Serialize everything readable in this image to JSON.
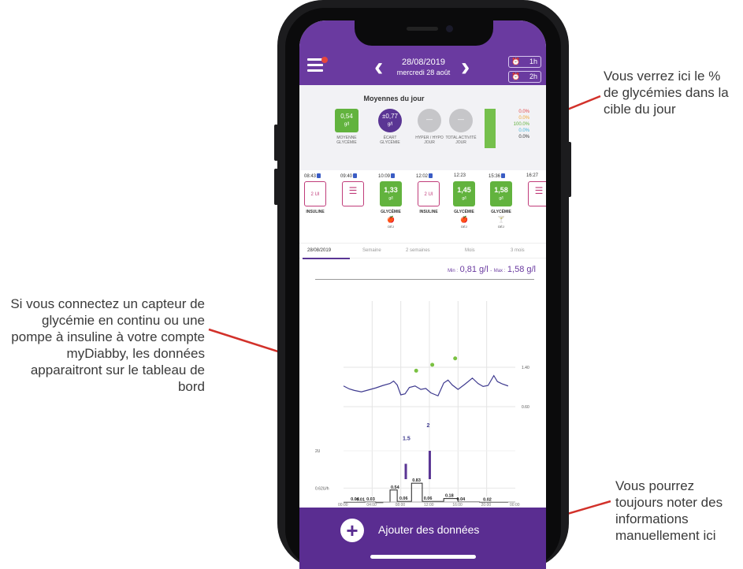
{
  "annotations": {
    "right_top": "Vous verrez ici le % de glycémies dans la cible du jour",
    "left_middle": "Si vous connectez un capteur de glycémie en continu ou une pompe à insuline à votre compte myDiabby, les données apparaitront sur le tableau de bord",
    "right_bottom": "Vous pourrez toujours noter des informations manuellement ici"
  },
  "header": {
    "date": "28/08/2019",
    "day": "mercredi 28 août",
    "timer1": "1h",
    "timer2": "2h"
  },
  "moyennes": {
    "title": "Moyennes du jour",
    "stats": [
      {
        "value": "0,54",
        "unit": "g/l",
        "label": "MOYENNE GLYCÉMIE"
      },
      {
        "value": "±0,77",
        "unit": "g/l",
        "label": "ÉCART GLYCÉMIE"
      },
      {
        "value": "—",
        "unit": "",
        "label": "HYPER / HYPO JOUR"
      },
      {
        "value": "—",
        "unit": "",
        "label": "TOTAL ACTIVITÉ JOUR"
      }
    ],
    "percentages": [
      "0.0%",
      "0.0%",
      "100.0%",
      "0.0%",
      "0.0%"
    ],
    "in_target_fraction": 1.0
  },
  "timeline": [
    {
      "time": "08:43",
      "type": "outline",
      "value": "2 UI",
      "label": "INSULINE",
      "sub": ""
    },
    {
      "time": "09:40",
      "type": "list",
      "value": "☰",
      "label": "",
      "sub": ""
    },
    {
      "time": "10:09",
      "type": "green",
      "value": "1,33",
      "unit": "g/l",
      "label": "GLYCÉMIE",
      "sub": "DÉJ"
    },
    {
      "time": "12:02",
      "type": "outline",
      "value": "2 UI",
      "label": "INSULINE",
      "sub": ""
    },
    {
      "time": "12:23",
      "type": "green",
      "value": "1,45",
      "unit": "g/l",
      "label": "GLYCÉMIE",
      "sub": "DÉJ"
    },
    {
      "time": "15:36",
      "type": "green",
      "value": "1,58",
      "unit": "g/l",
      "label": "GLYCÉMIE",
      "sub": "DÉJ"
    },
    {
      "time": "16:27",
      "type": "list",
      "value": "☰",
      "label": "",
      "sub": ""
    }
  ],
  "tabs": [
    "28/08/2019",
    "Semaine",
    "2 semaines",
    "Mois",
    "3 mois"
  ],
  "minmax": {
    "min_label": "Min :",
    "min": "0,81 g/l",
    "sep": "-",
    "max_label": "Max :",
    "max": "1,58 g/l"
  },
  "chart_data": {
    "type": "line",
    "x_ticks": [
      "00:00",
      "04:00",
      "08:00",
      "12:00",
      "16:00",
      "20:00",
      "00:00"
    ],
    "glucose_ref_labels": [
      "1.40",
      "0.60"
    ],
    "insulin_ref_labels": [
      "2U",
      "0.62U/h"
    ],
    "bolus_labels": [
      "1.5",
      "2"
    ],
    "basal_labels": [
      "0.04",
      "0.01",
      "0.03",
      "0.54",
      "0.06",
      "0.83",
      "0.06",
      "0.18",
      "0.04",
      "0.02"
    ],
    "cgm_points": [
      [
        0.0,
        1.02
      ],
      [
        0.8,
        0.96
      ],
      [
        1.5,
        0.93
      ],
      [
        2.5,
        0.9
      ],
      [
        3.5,
        0.94
      ],
      [
        4.5,
        0.98
      ],
      [
        5.5,
        1.03
      ],
      [
        6.5,
        1.07
      ],
      [
        7.0,
        1.12
      ],
      [
        7.5,
        1.04
      ],
      [
        8.0,
        0.84
      ],
      [
        8.6,
        0.86
      ],
      [
        9.2,
        0.99
      ],
      [
        10.0,
        1.02
      ],
      [
        10.8,
        0.95
      ],
      [
        11.5,
        0.97
      ],
      [
        12.2,
        0.88
      ],
      [
        13.2,
        0.82
      ],
      [
        14.0,
        1.08
      ],
      [
        14.6,
        1.14
      ],
      [
        15.2,
        1.04
      ],
      [
        16.0,
        0.95
      ],
      [
        17.0,
        1.06
      ],
      [
        18.0,
        1.18
      ],
      [
        18.8,
        1.07
      ],
      [
        19.5,
        1.01
      ],
      [
        20.2,
        1.03
      ],
      [
        21.0,
        1.23
      ],
      [
        21.5,
        1.11
      ],
      [
        22.2,
        1.06
      ],
      [
        23.0,
        1.02
      ]
    ],
    "glucose_readings": [
      [
        10.15,
        1.33
      ],
      [
        12.4,
        1.45
      ],
      [
        15.6,
        1.58
      ]
    ],
    "bolus_events": [
      [
        8.7,
        1.5
      ],
      [
        12.05,
        2.0
      ]
    ],
    "basal_steps": [
      [
        0.0,
        0.02
      ],
      [
        3.0,
        0.04
      ],
      [
        4.5,
        0.01
      ],
      [
        5.5,
        0.03
      ],
      [
        6.5,
        0.54
      ],
      [
        7.5,
        0.06
      ],
      [
        9.5,
        0.83
      ],
      [
        11.0,
        0.06
      ],
      [
        14.0,
        0.18
      ],
      [
        16.0,
        0.04
      ],
      [
        19.0,
        0.02
      ],
      [
        23.0,
        0.02
      ]
    ]
  },
  "bottom": {
    "label": "Ajouter des données"
  }
}
